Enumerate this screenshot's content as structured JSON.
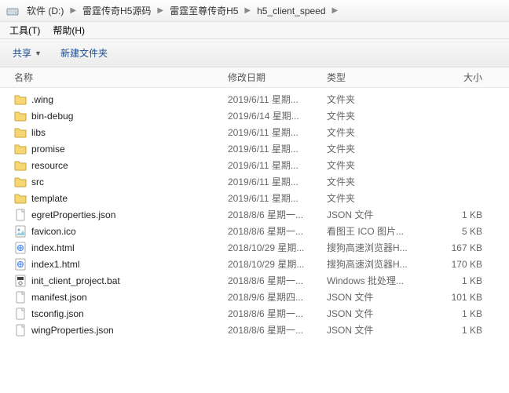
{
  "breadcrumb": {
    "items": [
      {
        "label": "软件 (D:)"
      },
      {
        "label": "雷霆传奇H5源码"
      },
      {
        "label": "雷霆至尊传奇H5"
      },
      {
        "label": "h5_client_speed"
      }
    ]
  },
  "menubar": {
    "items": [
      {
        "label": "工具(T)"
      },
      {
        "label": "帮助(H)"
      }
    ]
  },
  "toolbar": {
    "share": "共享",
    "newfolder": "新建文件夹"
  },
  "headers": {
    "name": "名称",
    "date": "修改日期",
    "type": "类型",
    "size": "大小"
  },
  "files": [
    {
      "icon": "folder",
      "name": ".wing",
      "date": "2019/6/11 星期...",
      "type": "文件夹",
      "size": ""
    },
    {
      "icon": "folder",
      "name": "bin-debug",
      "date": "2019/6/14 星期...",
      "type": "文件夹",
      "size": ""
    },
    {
      "icon": "folder",
      "name": "libs",
      "date": "2019/6/11 星期...",
      "type": "文件夹",
      "size": ""
    },
    {
      "icon": "folder",
      "name": "promise",
      "date": "2019/6/11 星期...",
      "type": "文件夹",
      "size": ""
    },
    {
      "icon": "folder",
      "name": "resource",
      "date": "2019/6/11 星期...",
      "type": "文件夹",
      "size": ""
    },
    {
      "icon": "folder",
      "name": "src",
      "date": "2019/6/11 星期...",
      "type": "文件夹",
      "size": ""
    },
    {
      "icon": "folder",
      "name": "template",
      "date": "2019/6/11 星期...",
      "type": "文件夹",
      "size": ""
    },
    {
      "icon": "file",
      "name": "egretProperties.json",
      "date": "2018/8/6 星期一...",
      "type": "JSON 文件",
      "size": "1 KB"
    },
    {
      "icon": "ico",
      "name": "favicon.ico",
      "date": "2018/8/6 星期一...",
      "type": "看图王 ICO 图片...",
      "size": "5 KB"
    },
    {
      "icon": "html",
      "name": "index.html",
      "date": "2018/10/29 星期...",
      "type": "搜狗高速浏览器H...",
      "size": "167 KB"
    },
    {
      "icon": "html",
      "name": "index1.html",
      "date": "2018/10/29 星期...",
      "type": "搜狗高速浏览器H...",
      "size": "170 KB"
    },
    {
      "icon": "bat",
      "name": "init_client_project.bat",
      "date": "2018/8/6 星期一...",
      "type": "Windows 批处理...",
      "size": "1 KB"
    },
    {
      "icon": "file",
      "name": "manifest.json",
      "date": "2018/9/6 星期四...",
      "type": "JSON 文件",
      "size": "101 KB"
    },
    {
      "icon": "file",
      "name": "tsconfig.json",
      "date": "2018/8/6 星期一...",
      "type": "JSON 文件",
      "size": "1 KB"
    },
    {
      "icon": "file",
      "name": "wingProperties.json",
      "date": "2018/8/6 星期一...",
      "type": "JSON 文件",
      "size": "1 KB"
    }
  ]
}
